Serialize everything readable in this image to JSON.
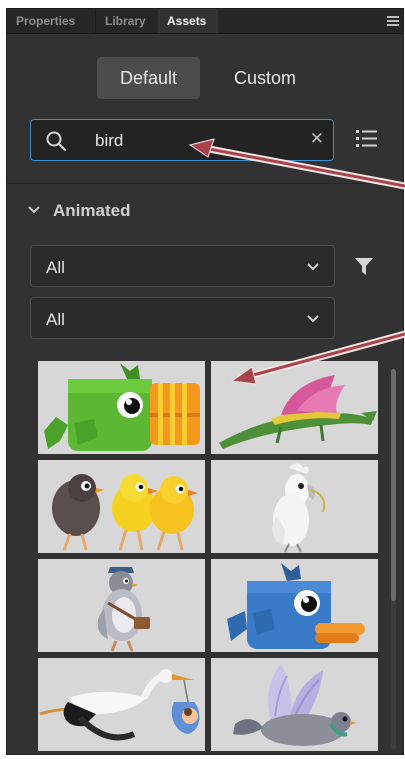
{
  "tabs": [
    {
      "label": "Properties",
      "active": false
    },
    {
      "label": "Library",
      "active": false
    },
    {
      "label": "Assets",
      "active": true
    }
  ],
  "panel_menu_icon": "hamburger-menu-icon",
  "segment": {
    "default_label": "Default",
    "custom_label": "Custom",
    "selected": "Default"
  },
  "search": {
    "value": "bird",
    "icon": "search-icon",
    "clear_icon": "close-icon"
  },
  "list_view_icon": "list-view-icon",
  "section": {
    "label": "Animated",
    "expanded": true
  },
  "filters": {
    "primary_value": "All",
    "secondary_value": "All",
    "filter_icon": "funnel-icon"
  },
  "assets": [
    {
      "kind": "green-square-bird"
    },
    {
      "kind": "pink-winged-dragon"
    },
    {
      "kind": "three-chicks"
    },
    {
      "kind": "white-cockatoo"
    },
    {
      "kind": "pigeon-postman"
    },
    {
      "kind": "blue-square-bird"
    },
    {
      "kind": "stork-with-baby"
    },
    {
      "kind": "flying-pigeon"
    }
  ],
  "colors": {
    "panel_bg": "#323232",
    "tab_bg": "#262626",
    "accent_focus": "#3d8fd1",
    "annotation_arrow": "#a8434b",
    "thumb_bg": "#d7d7d7"
  }
}
